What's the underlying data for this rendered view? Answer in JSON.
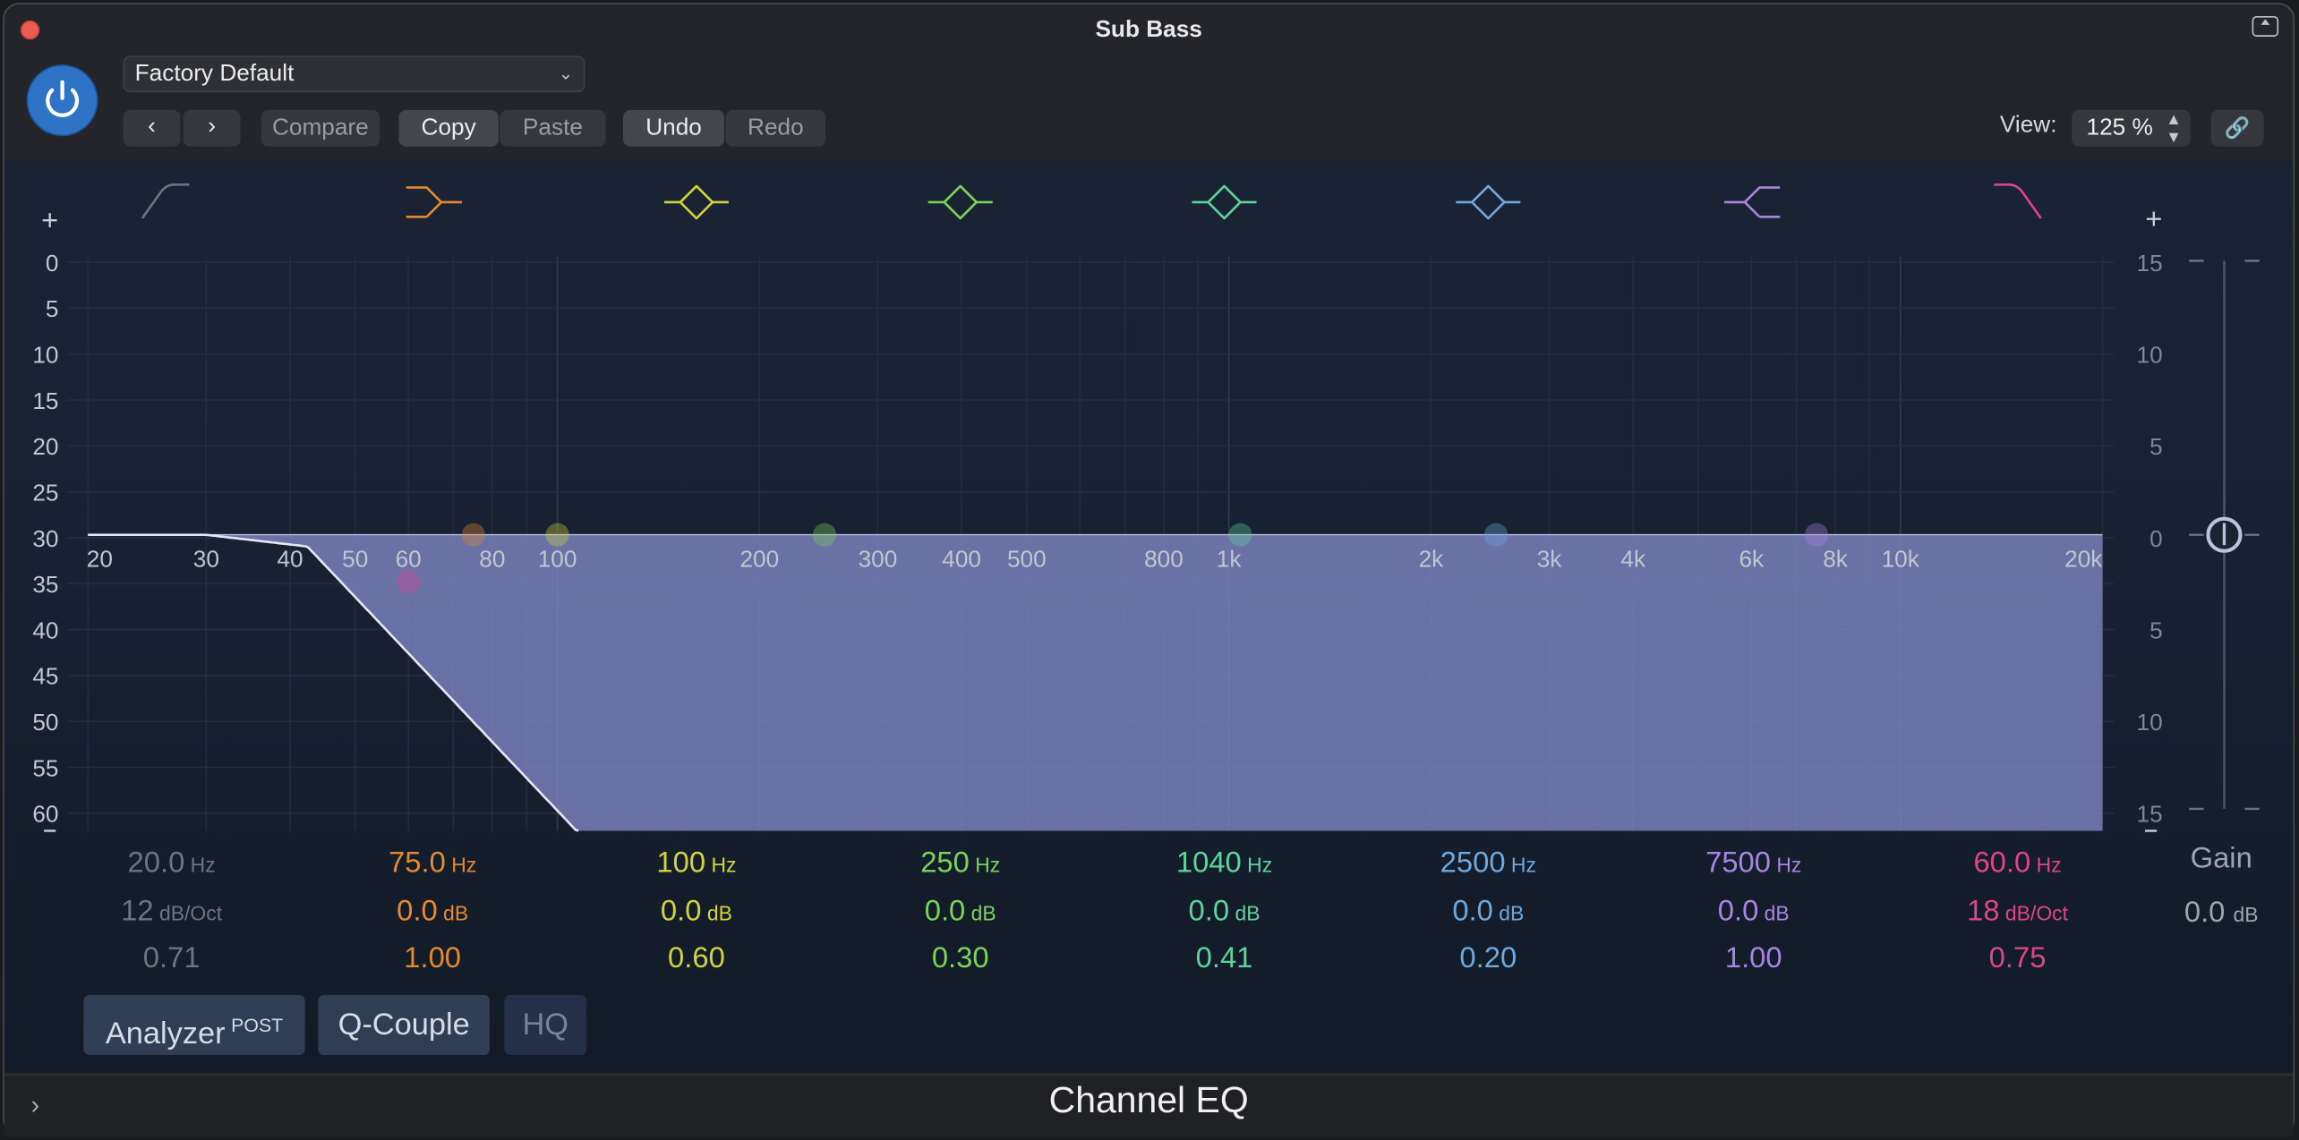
{
  "window": {
    "title": "Sub Bass"
  },
  "header": {
    "preset": "Factory Default",
    "compare": "Compare",
    "copy": "Copy",
    "paste": "Paste",
    "undo": "Undo",
    "redo": "Redo",
    "view_label": "View:",
    "view_value": "125 %"
  },
  "graph": {
    "db_left": [
      "0",
      "5",
      "10",
      "15",
      "20",
      "25",
      "30",
      "35",
      "40",
      "45",
      "50",
      "55",
      "60"
    ],
    "db_right": [
      "15",
      "10",
      "5",
      "0",
      "5",
      "10",
      "15"
    ],
    "freq_labels": [
      "20",
      "30",
      "40",
      "50",
      "60",
      "80",
      "100",
      "200",
      "300",
      "400",
      "500",
      "800",
      "1k",
      "2k",
      "3k",
      "4k",
      "6k",
      "8k",
      "10k",
      "20k"
    ],
    "plus": "+"
  },
  "bands": [
    {
      "freq": "20.0",
      "freq_unit": "Hz",
      "mid": "12",
      "mid_unit": "dB/Oct",
      "q": "0.71",
      "color": "#6f7480",
      "icon": "low-cut-icon"
    },
    {
      "freq": "75.0",
      "freq_unit": "Hz",
      "mid": "0.0",
      "mid_unit": "dB",
      "q": "1.00",
      "color": "#e58a2e",
      "icon": "low-shelf-icon"
    },
    {
      "freq": "100",
      "freq_unit": "Hz",
      "mid": "0.0",
      "mid_unit": "dB",
      "q": "0.60",
      "color": "#d4d43a",
      "icon": "bell-icon"
    },
    {
      "freq": "250",
      "freq_unit": "Hz",
      "mid": "0.0",
      "mid_unit": "dB",
      "q": "0.30",
      "color": "#7bd35a",
      "icon": "bell-icon"
    },
    {
      "freq": "1040",
      "freq_unit": "Hz",
      "mid": "0.0",
      "mid_unit": "dB",
      "q": "0.41",
      "color": "#5fd49a",
      "icon": "bell-icon"
    },
    {
      "freq": "2500",
      "freq_unit": "Hz",
      "mid": "0.0",
      "mid_unit": "dB",
      "q": "0.20",
      "color": "#6ea8dc",
      "icon": "bell-icon"
    },
    {
      "freq": "7500",
      "freq_unit": "Hz",
      "mid": "0.0",
      "mid_unit": "dB",
      "q": "1.00",
      "color": "#a984e0",
      "icon": "high-shelf-icon"
    },
    {
      "freq": "60.0",
      "freq_unit": "Hz",
      "mid": "18",
      "mid_unit": "dB/Oct",
      "q": "0.75",
      "color": "#e0438f",
      "icon": "high-cut-icon"
    }
  ],
  "gain": {
    "label": "Gain",
    "value": "0.0",
    "unit": "dB"
  },
  "bottom": {
    "analyzer": "Analyzer",
    "post": "POST",
    "qcouple": "Q-Couple",
    "hq": "HQ"
  },
  "footer": {
    "title": "Channel EQ"
  }
}
